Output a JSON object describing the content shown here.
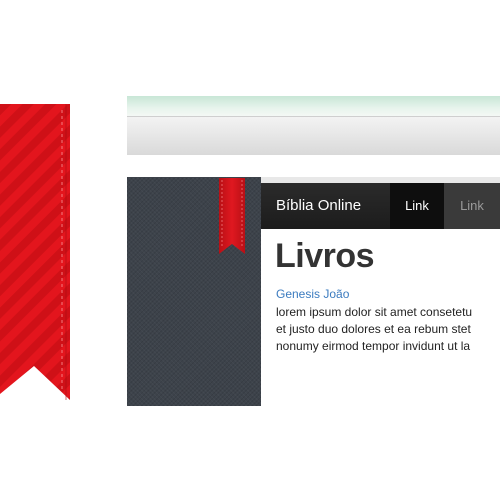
{
  "navbar": {
    "brand": "Bíblia Online",
    "links": [
      "Link",
      "Link"
    ]
  },
  "content": {
    "title": "Livros",
    "books": [
      "Genesis",
      "João"
    ],
    "paragraph_lines": [
      "lorem ipsum dolor sit amet consetetu",
      "et justo duo dolores et ea rebum stet",
      "nonumy eirmod tempor invidunt ut la"
    ]
  },
  "colors": {
    "ribbon": "#d9141c",
    "navbar": "#222222",
    "link": "#3b7bbf",
    "sidebar": "#3d434b"
  },
  "icons": [
    "bookmark-ribbon-icon",
    "bookmark-ribbon-icon"
  ]
}
